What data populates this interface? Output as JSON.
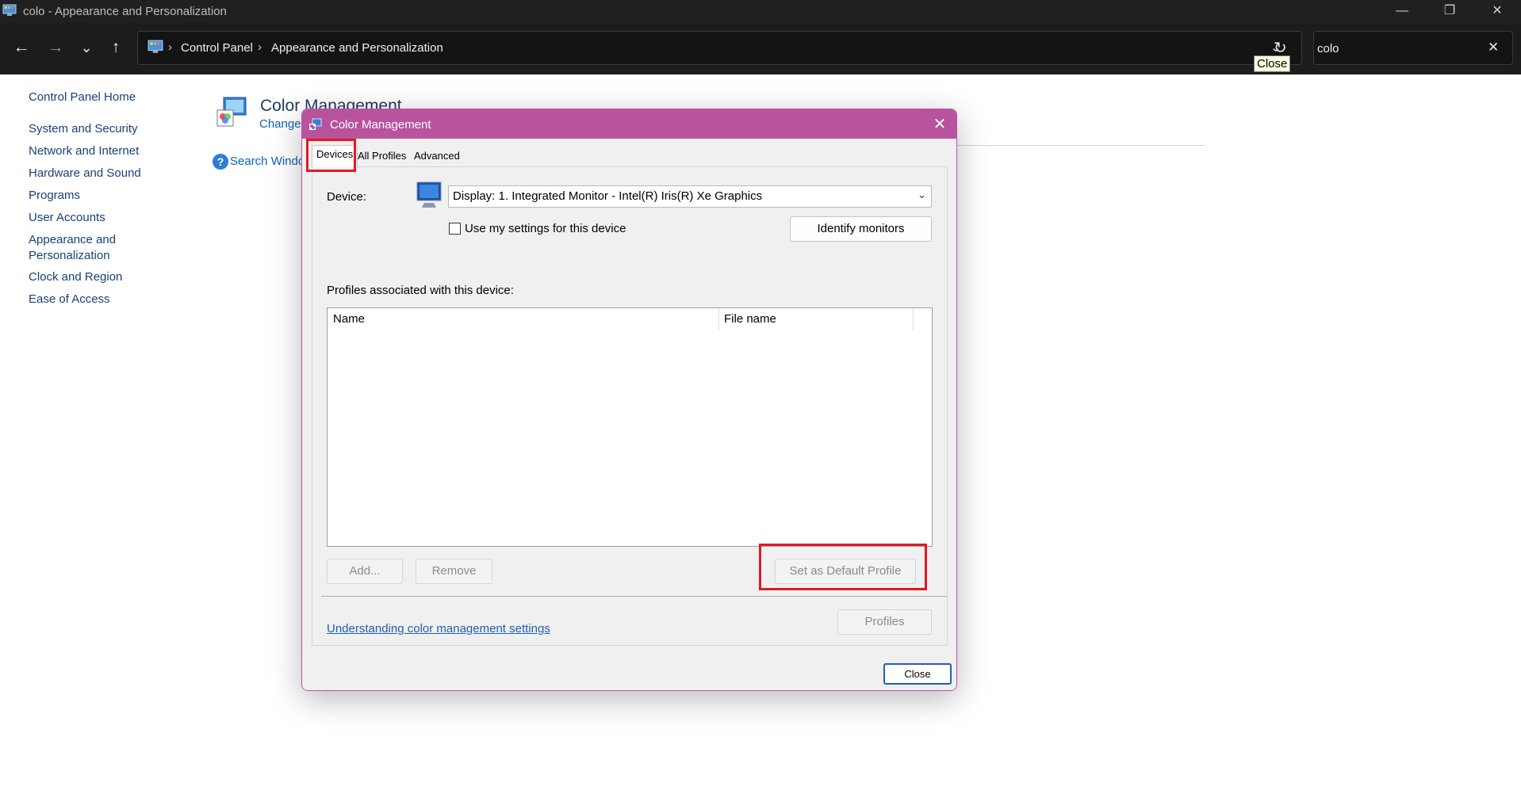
{
  "window": {
    "title": "colo - Appearance and Personalization",
    "minimize_glyph": "—",
    "restore_glyph": "❐",
    "close_glyph": "✕"
  },
  "nav": {
    "back_glyph": "←",
    "forward_glyph": "→",
    "recent_glyph": "⌄",
    "up_glyph": "↑"
  },
  "address": {
    "separator": "›",
    "crumbs": [
      "Control Panel",
      "Appearance and Personalization"
    ],
    "dropdown_glyph": "⌄",
    "refresh_glyph": "↻",
    "tooltip": "Close"
  },
  "search": {
    "value": "colo",
    "clear_glyph": "✕"
  },
  "sidebar": {
    "home": "Control Panel Home",
    "items": [
      "System and Security",
      "Network and Internet",
      "Hardware and Sound",
      "Programs",
      "User Accounts",
      "Appearance and",
      "Personalization",
      "Clock and Region",
      "Ease of Access"
    ]
  },
  "background": {
    "heading": "Color Management",
    "sub_link": "Change",
    "help_glyph": "?",
    "search_link": "Search Windo"
  },
  "dialog": {
    "title": "Color Management",
    "close_glyph": "✕",
    "tabs": [
      "Devices",
      "All Profiles",
      "Advanced"
    ],
    "device_label": "Device:",
    "device_value": "Display: 1. Integrated Monitor - Intel(R) Iris(R) Xe Graphics",
    "dropdown_glyph": "⌄",
    "use_settings_label": "Use my settings for this device",
    "identify_button": "Identify monitors",
    "profiles_label": "Profiles associated with this device:",
    "columns": [
      "Name",
      "File name"
    ],
    "add_button": "Add...",
    "remove_button": "Remove",
    "set_default_button": "Set as Default Profile",
    "help_link": "Understanding color management settings",
    "profiles_button": "Profiles",
    "close_button": "Close"
  }
}
